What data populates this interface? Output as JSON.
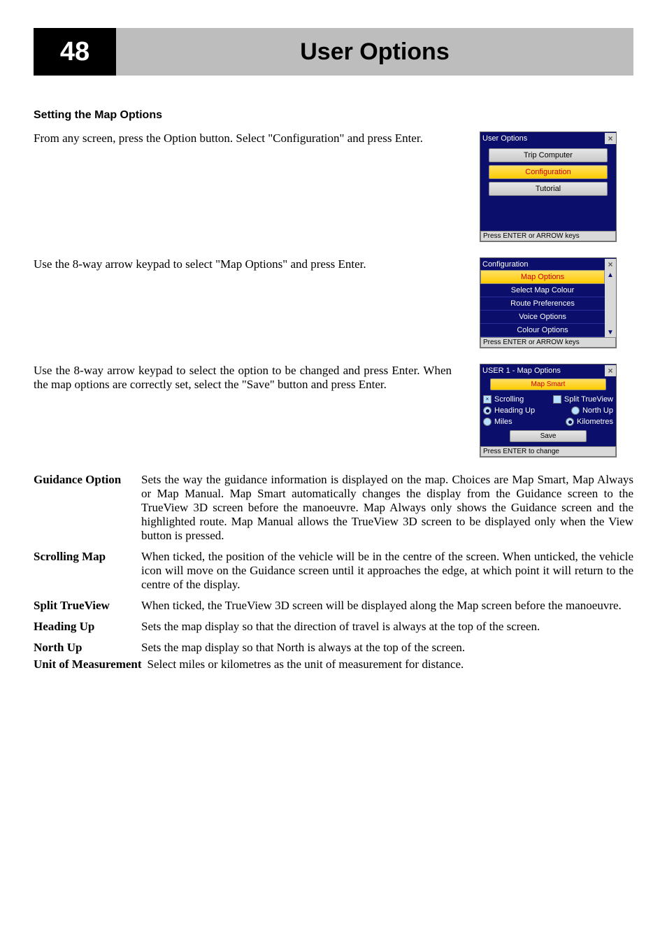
{
  "page_number": "48",
  "page_title": "User Options",
  "section_title": "Setting the Map Options",
  "para1": "From any screen, press the Option button. Select \"Configuration\" and press Enter.",
  "para2": "Use the 8-way arrow keypad to select \"Map Options\" and press Enter.",
  "para3": "Use the 8-way arrow keypad to select the option to be changed and press Enter. When the map options are correctly set, select the \"Save\" button and press Enter.",
  "screen1": {
    "title": "User Options",
    "items": [
      "Trip Computer",
      "Configuration",
      "Tutorial"
    ],
    "highlight_index": 1,
    "status": "Press ENTER or ARROW keys"
  },
  "screen2": {
    "title": "Configuration",
    "items": [
      "Map Options",
      "Select Map Colour",
      "Route Preferences",
      "Voice Options",
      "Colour Options"
    ],
    "highlight_index": 0,
    "status": "Press ENTER or ARROW keys"
  },
  "screen3": {
    "title": "USER 1 - Map Options",
    "top_highlight": "Map Smart",
    "row1": {
      "cb1_checked": true,
      "label1": "Scrolling",
      "cb2_checked": false,
      "label2": "Split TrueView"
    },
    "row2": {
      "rb1_checked": true,
      "label1": "Heading Up",
      "rb2_checked": false,
      "label2": "North Up"
    },
    "row3": {
      "rb1_checked": false,
      "label1": "Miles",
      "rb2_checked": true,
      "label2": "Kilometres"
    },
    "save": "Save",
    "status": "Press ENTER to change"
  },
  "defs": [
    {
      "term": "Guidance Option",
      "desc": "Sets the way the guidance information is displayed on the map. Choices are Map Smart, Map Always or Map Manual. Map Smart automatically changes the display from the Guidance screen to the TrueView 3D screen before the manoeuvre. Map Always only shows the Guidance screen and the highlighted route. Map Manual allows the TrueView 3D screen to be displayed only when the View button is pressed."
    },
    {
      "term": "Scrolling Map",
      "desc": "When ticked, the position of the vehicle will be in the centre of the screen. When unticked, the vehicle icon will move on the Guidance screen until it approaches the edge, at which point it will  return to the centre of the display."
    },
    {
      "term": "Split TrueView",
      "desc": "When ticked, the TrueView 3D screen will be displayed along the Map screen before the manoeuvre."
    },
    {
      "term": "Heading Up",
      "desc": "Sets the map display so that the direction of travel is always at the top of the screen."
    },
    {
      "term": "North Up",
      "desc": "Sets the map display so that North is always at the top of the screen."
    }
  ],
  "last": {
    "term": "Unit of Measurement",
    "desc": "Select miles or kilometres as the unit of measurement for distance."
  }
}
